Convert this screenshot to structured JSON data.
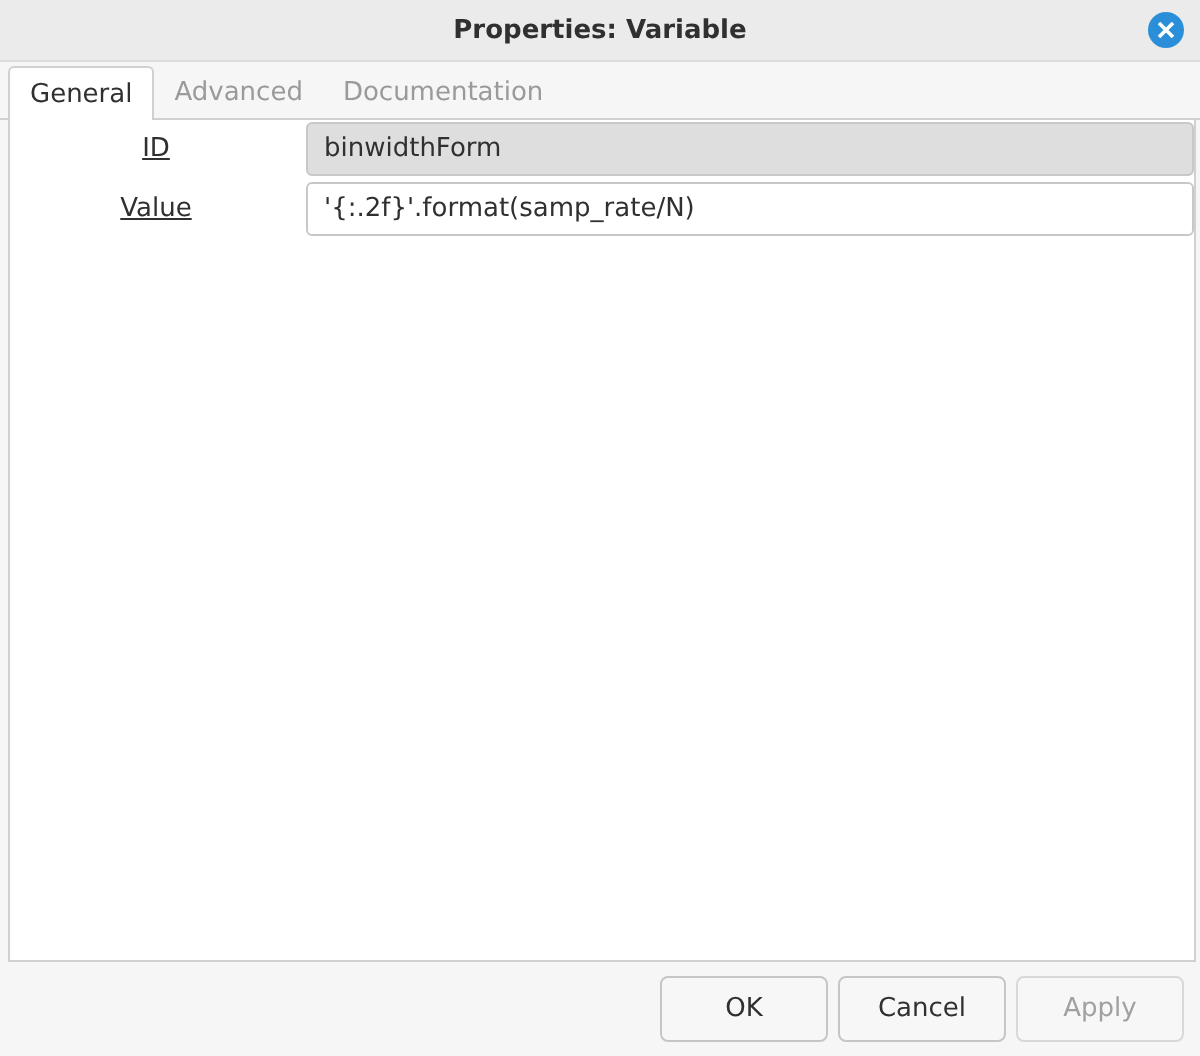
{
  "window": {
    "title": "Properties: Variable"
  },
  "tabs": [
    {
      "label": "General",
      "selected": true
    },
    {
      "label": "Advanced",
      "selected": false
    },
    {
      "label": "Documentation",
      "selected": false
    }
  ],
  "fields": [
    {
      "label": "ID",
      "value": "binwidthForm",
      "disabled": true
    },
    {
      "label": "Value",
      "value": "'{:.2f}'.format(samp_rate/N)",
      "disabled": false
    }
  ],
  "buttons": [
    {
      "label": "OK",
      "disabled": false
    },
    {
      "label": "Cancel",
      "disabled": false
    },
    {
      "label": "Apply",
      "disabled": true
    }
  ]
}
